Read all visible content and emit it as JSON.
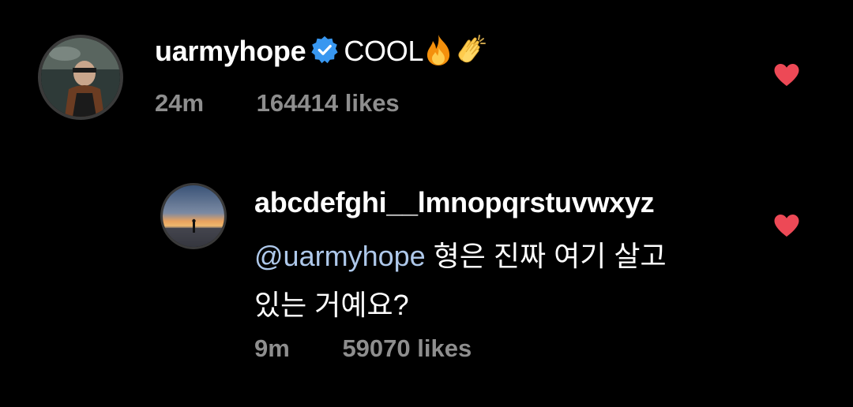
{
  "comments": [
    {
      "username": "uarmyhope",
      "verified": true,
      "text": "COOL",
      "emojis": [
        "fire-emoji",
        "clapping-hands-emoji"
      ],
      "time": "24m",
      "likes": "164414 likes",
      "liked": true
    },
    {
      "username": "abcdefghi__lmnopqrstuvwxyz",
      "mention": "@uarmyhope",
      "text_line1": " 형은 진짜 여기 살고",
      "text_line2": "있는 거예요?",
      "time": "9m",
      "likes": "59070 likes",
      "liked": true
    }
  ],
  "colors": {
    "background": "#000000",
    "text": "#ffffff",
    "meta": "#8e8e8e",
    "mention": "#aec8ea",
    "heart": "#ed4956",
    "verified": "#3897f0"
  },
  "icons": {
    "heart": "heart-icon",
    "verified": "verified-badge-icon"
  }
}
